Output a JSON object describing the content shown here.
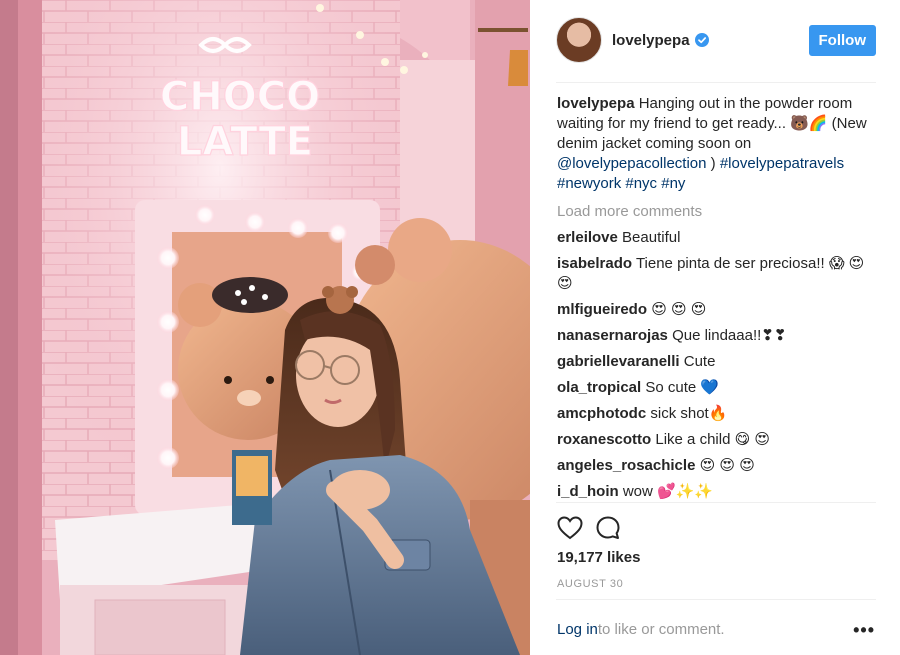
{
  "post": {
    "username": "lovelypepa",
    "follow_label": "Follow",
    "caption": {
      "username": "lovelypepa",
      "text": "Hanging out in the powder room waiting for my friend to get ready... 🐻🌈 (New denim jacket coming soon on ",
      "mention": "@lovelypepacollection",
      "after_mention": " ) ",
      "tags": [
        "#lovelypepatravels",
        "#newyork",
        "#nyc",
        "#ny"
      ]
    },
    "load_more": "Load more comments",
    "comments": [
      {
        "user": "erleilove",
        "text": "Beautiful"
      },
      {
        "user": "isabelrado",
        "text": "Tiene pinta de ser preciosa!! 😱 😍 😍"
      },
      {
        "user": "mlfigueiredo",
        "text": "😍 😍 😍"
      },
      {
        "user": "nanasernarojas",
        "text": "Que lindaaa!!❣❣"
      },
      {
        "user": "gabriellevaranelli",
        "text": "Cute"
      },
      {
        "user": "ola_tropical",
        "text": "So cute 💙"
      },
      {
        "user": "amcphotodc",
        "text": "sick shot🔥"
      },
      {
        "user": "roxanescotto",
        "text": "Like a child 😋 😍"
      },
      {
        "user": "angeles_rosachicle",
        "text": "😍 😍 😍"
      },
      {
        "user": "i_d_hoin",
        "text": "wow 💕✨✨"
      }
    ],
    "likes": "19,177 likes",
    "date": "AUGUST 30",
    "login_link": "Log in",
    "login_rest": " to like or comment.",
    "more_label": "•••",
    "neon_sign": [
      "CHOCO",
      "LATTE"
    ],
    "icons": {
      "verified": "verified-badge-icon",
      "like": "heart-icon",
      "comment": "comment-bubble-icon",
      "more": "more-options-icon"
    },
    "colors": {
      "accent": "#3897f0",
      "link": "#003569",
      "muted": "#999999"
    }
  }
}
